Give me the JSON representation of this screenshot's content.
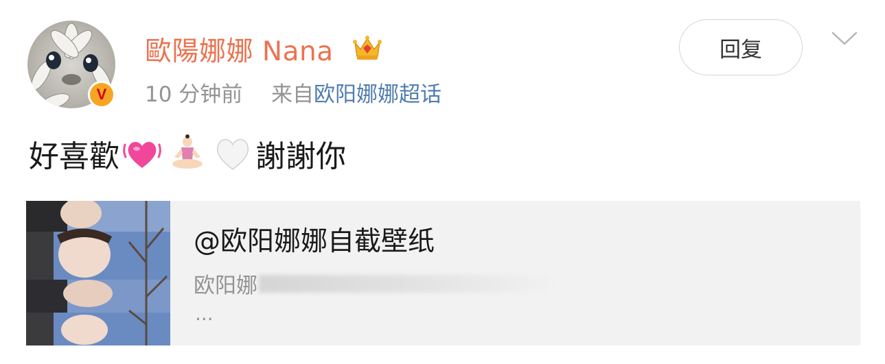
{
  "post": {
    "author": {
      "name": "歐陽娜娜 Nana",
      "verified_badge": "V",
      "crown_icon": "crown-icon"
    },
    "meta": {
      "time": "10 分钟前",
      "from_prefix": "来自",
      "source": "欧阳娜娜超话"
    },
    "reply_label": "回复",
    "content": {
      "text_before": "好喜歡",
      "text_after": "謝謝你",
      "emojis": [
        "heart-pulse-emoji",
        "meditation-emoji",
        "white-heart-emoji"
      ]
    },
    "card": {
      "title": "@欧阳娜娜自截壁纸",
      "subtitle": "欧阳娜",
      "ellipsis": "..."
    }
  },
  "colors": {
    "username": "#eb7350",
    "link": "#507daf",
    "meta": "#939393",
    "card_bg": "#f2f2f2"
  }
}
